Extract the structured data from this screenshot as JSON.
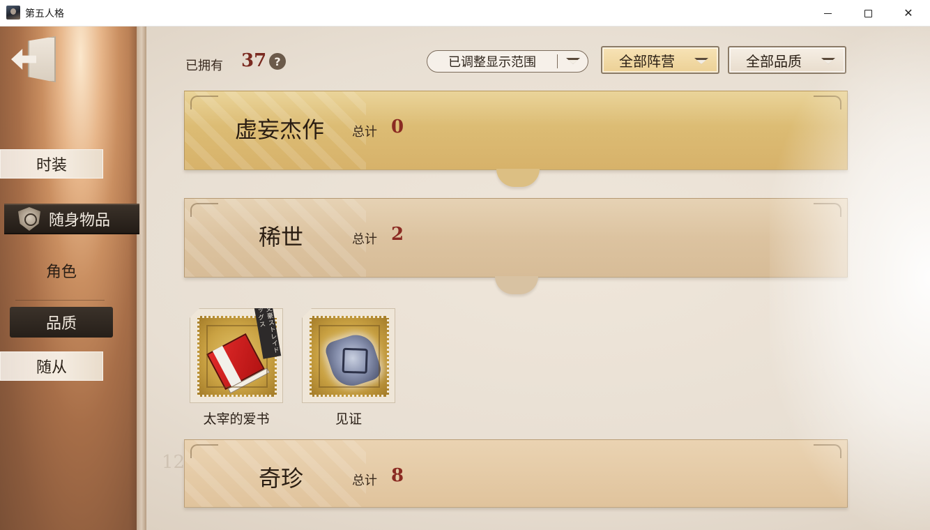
{
  "window": {
    "title": "第五人格",
    "minimize_label": "—",
    "close_label": "✕"
  },
  "sidebar": {
    "items": [
      {
        "label": "时装"
      },
      {
        "label": "随身物品"
      },
      {
        "label": "角色"
      },
      {
        "label": "品质"
      },
      {
        "label": "随从"
      }
    ]
  },
  "header": {
    "owned_label": "已拥有",
    "owned_count": "37",
    "help_label": "?",
    "range_filter": "已调整显示范围",
    "camp_filter": "全部阵营",
    "quality_filter": "全部品质"
  },
  "categories": [
    {
      "title": "虚妄杰作",
      "total_label": "总计",
      "count": "0"
    },
    {
      "title": "稀世",
      "total_label": "总计",
      "count": "2"
    },
    {
      "title": "奇珍",
      "total_label": "总计",
      "count": "8"
    }
  ],
  "items": [
    {
      "name": "太宰的爱书",
      "tag": "文豪ストレイドッグス"
    },
    {
      "name": "见证"
    }
  ],
  "background": {
    "watermark": "12"
  },
  "colors": {
    "accent_dark": "#2b231b",
    "count_red": "#8a2a22",
    "gold_banner": "#dcbc74"
  }
}
